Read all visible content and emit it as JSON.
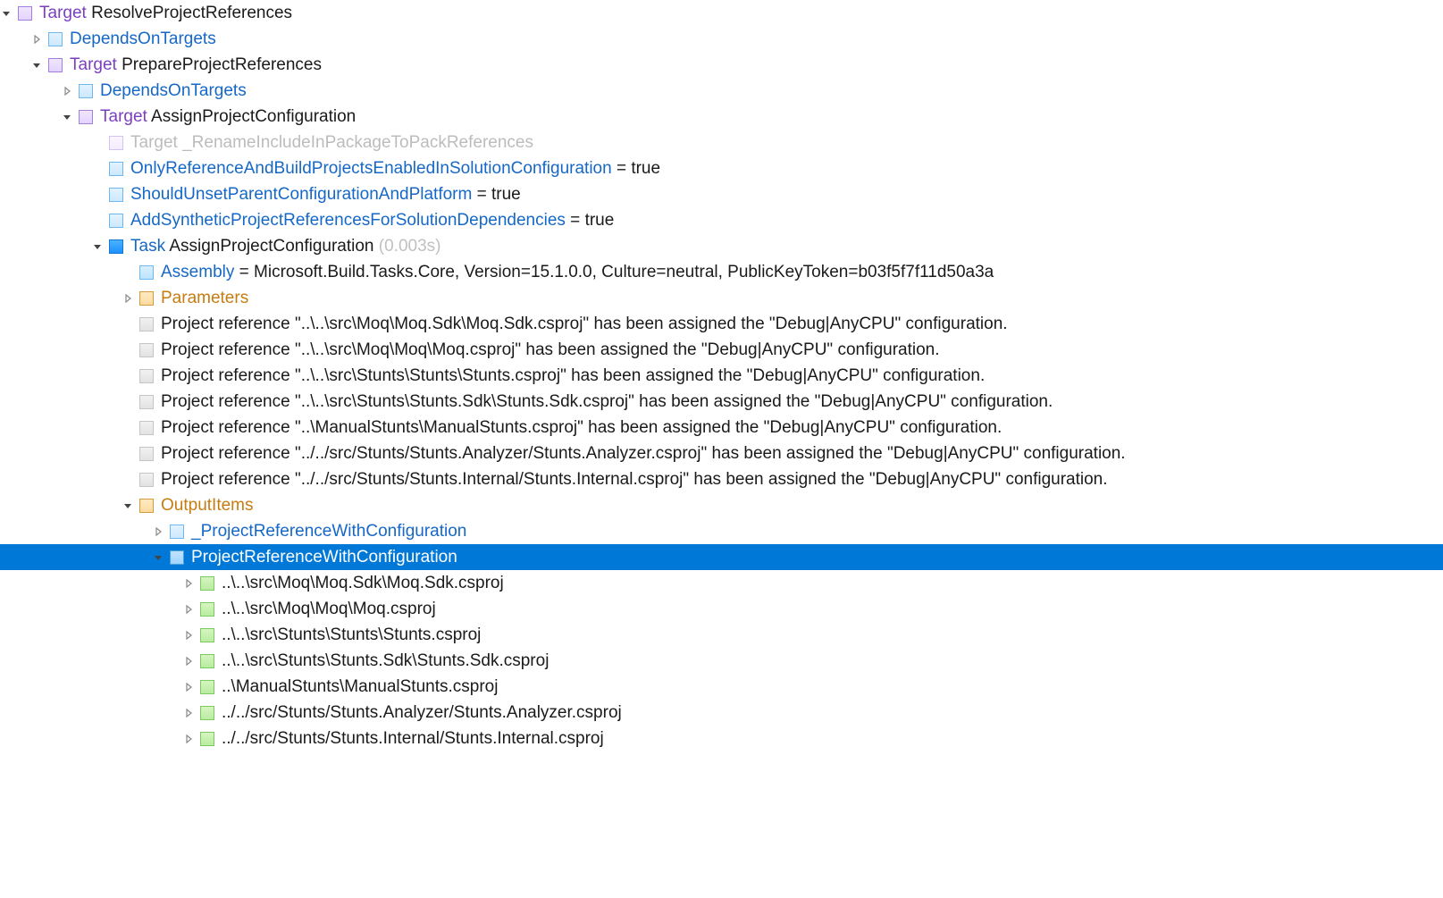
{
  "words": {
    "target": "Target",
    "task": "Task",
    "true_": "true",
    "equals": " = ",
    "assembly": "Assembly"
  },
  "tree": {
    "root": {
      "name": "ResolveProjectReferences",
      "depends": "DependsOnTargets",
      "child": {
        "name": "PrepareProjectReferences",
        "depends": "DependsOnTargets",
        "child": {
          "name": "AssignProjectConfiguration",
          "disabled_target": "_RenameIncludeInPackageToPackReferences",
          "props": [
            "OnlyReferenceAndBuildProjectsEnabledInSolutionConfiguration",
            "ShouldUnsetParentConfigurationAndPlatform",
            "AddSyntheticProjectReferencesForSolutionDependencies"
          ],
          "task": {
            "name": "AssignProjectConfiguration",
            "duration": "(0.003s)",
            "assembly_val": "Microsoft.Build.Tasks.Core, Version=15.1.0.0, Culture=neutral, PublicKeyToken=b03f5f7f11d50a3a",
            "parameters": "Parameters",
            "messages": [
              "Project reference \"..\\..\\src\\Moq\\Moq.Sdk\\Moq.Sdk.csproj\" has been assigned the \"Debug|AnyCPU\" configuration.",
              "Project reference \"..\\..\\src\\Moq\\Moq\\Moq.csproj\" has been assigned the \"Debug|AnyCPU\" configuration.",
              "Project reference \"..\\..\\src\\Stunts\\Stunts\\Stunts.csproj\" has been assigned the \"Debug|AnyCPU\" configuration.",
              "Project reference \"..\\..\\src\\Stunts\\Stunts.Sdk\\Stunts.Sdk.csproj\" has been assigned the \"Debug|AnyCPU\" configuration.",
              "Project reference \"..\\ManualStunts\\ManualStunts.csproj\" has been assigned the \"Debug|AnyCPU\" configuration.",
              "Project reference \"../../src/Stunts/Stunts.Analyzer/Stunts.Analyzer.csproj\" has been assigned the \"Debug|AnyCPU\" configuration.",
              "Project reference \"../../src/Stunts/Stunts.Internal/Stunts.Internal.csproj\" has been assigned the \"Debug|AnyCPU\" configuration."
            ],
            "output_items": {
              "label": "OutputItems",
              "underscore": "_ProjectReferenceWithConfiguration",
              "main": "ProjectReferenceWithConfiguration",
              "items": [
                "..\\..\\src\\Moq\\Moq.Sdk\\Moq.Sdk.csproj",
                "..\\..\\src\\Moq\\Moq\\Moq.csproj",
                "..\\..\\src\\Stunts\\Stunts\\Stunts.csproj",
                "..\\..\\src\\Stunts\\Stunts.Sdk\\Stunts.Sdk.csproj",
                "..\\ManualStunts\\ManualStunts.csproj",
                "../../src/Stunts/Stunts.Analyzer/Stunts.Analyzer.csproj",
                "../../src/Stunts/Stunts.Internal/Stunts.Internal.csproj"
              ]
            }
          }
        }
      }
    }
  }
}
